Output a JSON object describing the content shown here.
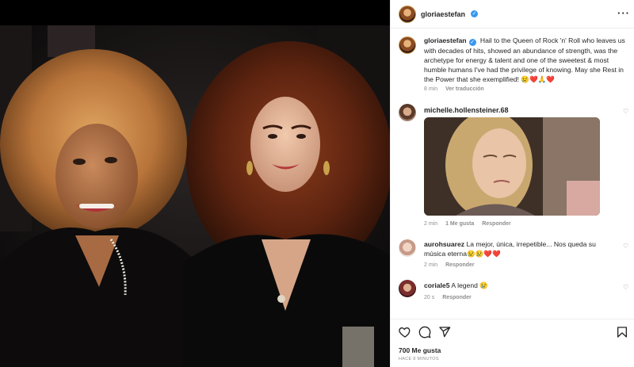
{
  "post": {
    "username": "gloriaestefan",
    "caption": "Hail to the Queen of Rock 'n' Roll who leaves us with decades of hits, showed an abundance of strength, was the archetype for energy & talent and one of the sweetest & most humble humans I've had the privilege of knowing. May she Rest in the Power that she exemplified! 😢❤️🙏❤️",
    "caption_time": "8 min",
    "see_translation": "Ver traducción",
    "more_icon": "more-horizontal-icon"
  },
  "comments": [
    {
      "username": "michelle.hollensteiner.68",
      "text": "",
      "has_gif": true,
      "time": "2 min",
      "likes": "1 Me gusta",
      "reply": "Responder"
    },
    {
      "username": "aurohsuarez",
      "text": "La mejor, única, irrepetible... Nos queda su música eterna😢😢❤️❤️",
      "time": "2 min",
      "reply": "Responder"
    },
    {
      "username": "coriale5",
      "text": "A legend 😢",
      "time": "20 s",
      "reply": "Responder"
    }
  ],
  "footer": {
    "likes": "700 Me gusta",
    "time_ago": "HACE 8 MINUTOS",
    "icons": [
      "heart-icon",
      "comment-icon",
      "share-icon",
      "bookmark-icon"
    ]
  },
  "colors": {
    "verified": "#3897f0",
    "text": "#262626",
    "muted": "#8e8e8e",
    "divider": "#efefef"
  }
}
